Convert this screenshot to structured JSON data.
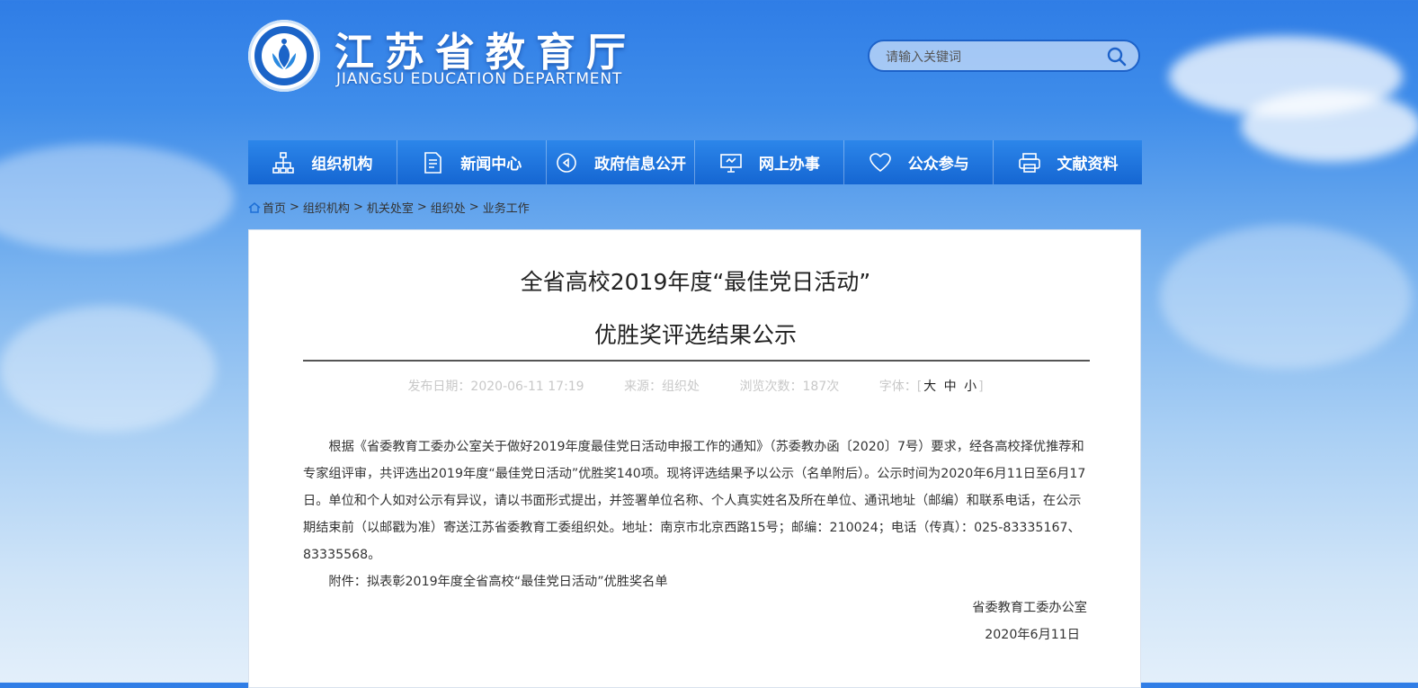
{
  "site": {
    "title": "江苏省教育厅",
    "subtitle": "JIANGSU EDUCATION DEPARTMENT",
    "search_placeholder": "请输入关键词"
  },
  "nav": [
    {
      "label": "组织机构",
      "icon": "org-chart-icon"
    },
    {
      "label": "新闻中心",
      "icon": "document-icon"
    },
    {
      "label": "政府信息公开",
      "icon": "speaker-icon"
    },
    {
      "label": "网上办事",
      "icon": "monitor-icon"
    },
    {
      "label": "公众参与",
      "icon": "heart-icon"
    },
    {
      "label": "文献资料",
      "icon": "printer-icon"
    }
  ],
  "breadcrumb": [
    "首页",
    "组织机构",
    "机关处室",
    "组织处",
    "业务工作"
  ],
  "article": {
    "title_line1": "全省高校2019年度“最佳党日活动”",
    "title_line2": "优胜奖评选结果公示",
    "meta": {
      "date": "发布日期：2020-06-11 17:19",
      "source": "来源：组织处",
      "views": "浏览次数：187次",
      "font_label": "字体：",
      "bracket_open": "[",
      "size_large": "大",
      "size_medium": "中",
      "size_small": "小",
      "bracket_close": "]"
    },
    "paragraph1": "根据《省委教育工委办公室关于做好2019年度最佳党日活动申报工作的通知》（苏委教办函〔2020〕7号）要求，经各高校择优推荐和专家组评审，共评选出2019年度“最佳党日活动”优胜奖140项。现将评选结果予以公示（名单附后）。公示时间为2020年6月11日至6月17日。单位和个人如对公示有异议，请以书面形式提出，并签署单位名称、个人真实姓名及所在单位、通讯地址（邮编）和联系电话，在公示期结束前（以邮戳为准）寄送江苏省委教育工委组织处。地址：南京市北京西路15号；邮编：210024；电话（传真）：025-83335167、83335568。",
    "paragraph2": "附件：拟表彰2019年度全省高校“最佳党日活动”优胜奖名单",
    "signature": "省委教育工委办公室",
    "sign_date": "2020年6月11日"
  }
}
